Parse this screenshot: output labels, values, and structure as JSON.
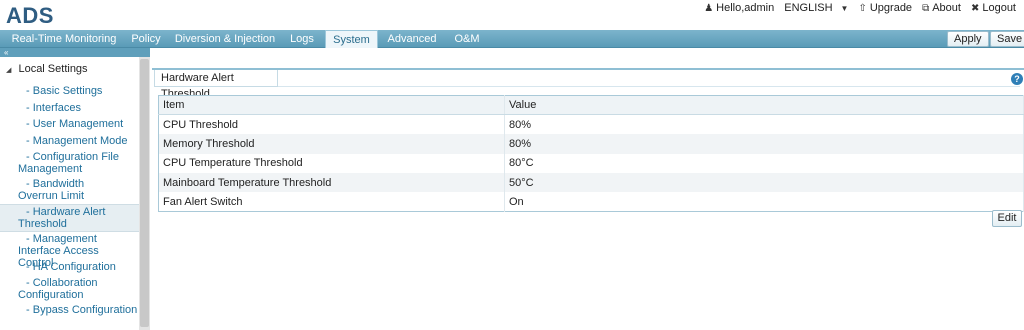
{
  "app": {
    "logo": "ADS"
  },
  "header": {
    "user": "Hello,admin",
    "language": "ENGLISH",
    "upgrade": "Upgrade",
    "about": "About",
    "logout": "Logout",
    "icons": {
      "user": "user-icon",
      "upgrade": "upgrade-arrow-icon",
      "about": "about-icon",
      "logout": "close-x-icon",
      "language": "chevron-down-icon"
    }
  },
  "nav": {
    "items": [
      {
        "label": "Real-Time Monitoring"
      },
      {
        "label": "Policy"
      },
      {
        "label": "Diversion & Injection"
      },
      {
        "label": "Logs"
      },
      {
        "label": "System",
        "active": true
      },
      {
        "label": "Advanced"
      },
      {
        "label": "O&M"
      }
    ],
    "apply_label": "Apply",
    "save_label": "Save"
  },
  "sidebar": {
    "collapse_glyph": "«",
    "group": "Local Settings",
    "items": [
      {
        "label": "Basic Settings"
      },
      {
        "label": "Interfaces"
      },
      {
        "label": "User Management"
      },
      {
        "label": "Management Mode"
      },
      {
        "label": "Configuration File Management"
      },
      {
        "label": "Bandwidth Overrun Limit"
      },
      {
        "label": "Hardware Alert Threshold",
        "active": true
      },
      {
        "label": "Management Interface Access Control"
      },
      {
        "label": "HA Configuration"
      },
      {
        "label": "Collaboration Configuration"
      },
      {
        "label": "Bypass Configuration"
      }
    ]
  },
  "main": {
    "tab": "Hardware Alert Threshold",
    "help": "?",
    "table": {
      "headers": [
        "Item",
        "Value"
      ],
      "rows": [
        [
          "CPU Threshold",
          "80%"
        ],
        [
          "Memory Threshold",
          "80%"
        ],
        [
          "CPU Temperature Threshold",
          "80°C"
        ],
        [
          "Mainboard Temperature Threshold",
          "50°C"
        ],
        [
          "Fan Alert Switch",
          "On"
        ]
      ]
    },
    "edit_label": "Edit"
  },
  "colors": {
    "accent": "#5a9bb7",
    "link": "#1f6f9b",
    "logo": "#2f5d82"
  }
}
